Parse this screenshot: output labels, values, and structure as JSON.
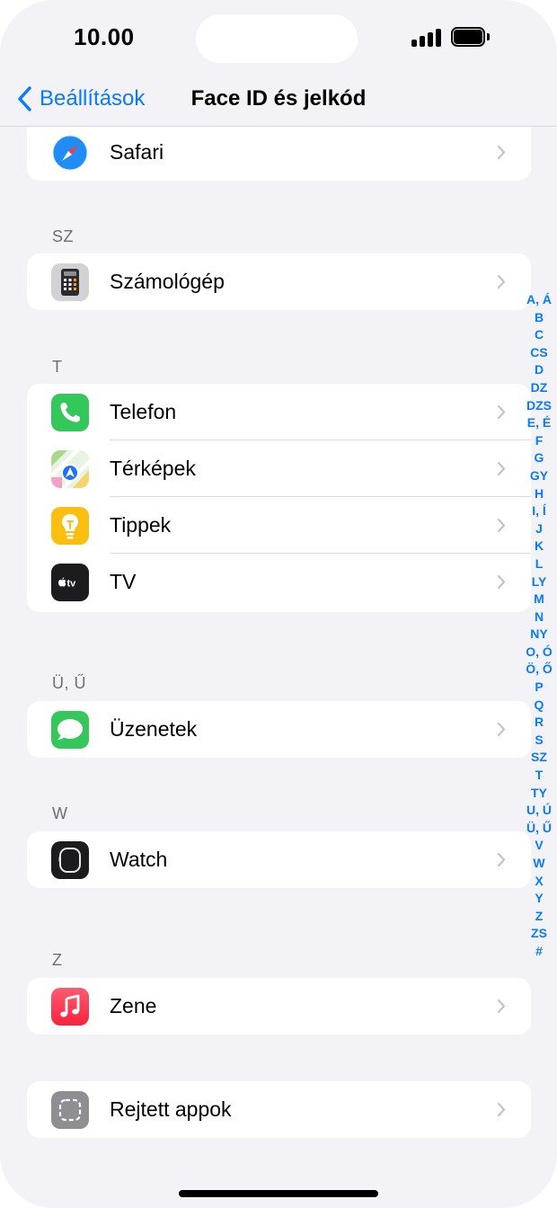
{
  "status": {
    "time": "10.00"
  },
  "nav": {
    "back_label": "Beállítások",
    "title": "Face ID és jelkód"
  },
  "sections": {
    "safari": {
      "label": "Safari"
    },
    "sz": {
      "header": "SZ",
      "items": [
        {
          "label": "Számológép",
          "icon": "calculator-icon"
        }
      ]
    },
    "t": {
      "header": "T",
      "items": [
        {
          "label": "Telefon",
          "icon": "phone-icon"
        },
        {
          "label": "Térképek",
          "icon": "maps-icon"
        },
        {
          "label": "Tippek",
          "icon": "tips-icon"
        },
        {
          "label": "TV",
          "icon": "tv-icon"
        }
      ]
    },
    "uu": {
      "header": "Ü, Ű",
      "items": [
        {
          "label": "Üzenetek",
          "icon": "messages-icon"
        }
      ]
    },
    "w": {
      "header": "W",
      "items": [
        {
          "label": "Watch",
          "icon": "watch-icon"
        }
      ]
    },
    "z": {
      "header": "Z",
      "items": [
        {
          "label": "Zene",
          "icon": "music-icon"
        }
      ]
    },
    "hidden": {
      "items": [
        {
          "label": "Rejtett appok",
          "icon": "hidden-apps-icon"
        }
      ]
    }
  },
  "index_letters": [
    "A, Á",
    "B",
    "C",
    "CS",
    "D",
    "DZ",
    "DZS",
    "E, É",
    "F",
    "G",
    "GY",
    "H",
    "I, Í",
    "J",
    "K",
    "L",
    "LY",
    "M",
    "N",
    "NY",
    "O, Ó",
    "Ö, Ő",
    "P",
    "Q",
    "R",
    "S",
    "SZ",
    "T",
    "TY",
    "U, Ú",
    "Ü, Ű",
    "V",
    "W",
    "X",
    "Y",
    "Z",
    "ZS",
    "#"
  ],
  "colors": {
    "accent": "#0a7aff",
    "background": "#f2f2f7"
  }
}
